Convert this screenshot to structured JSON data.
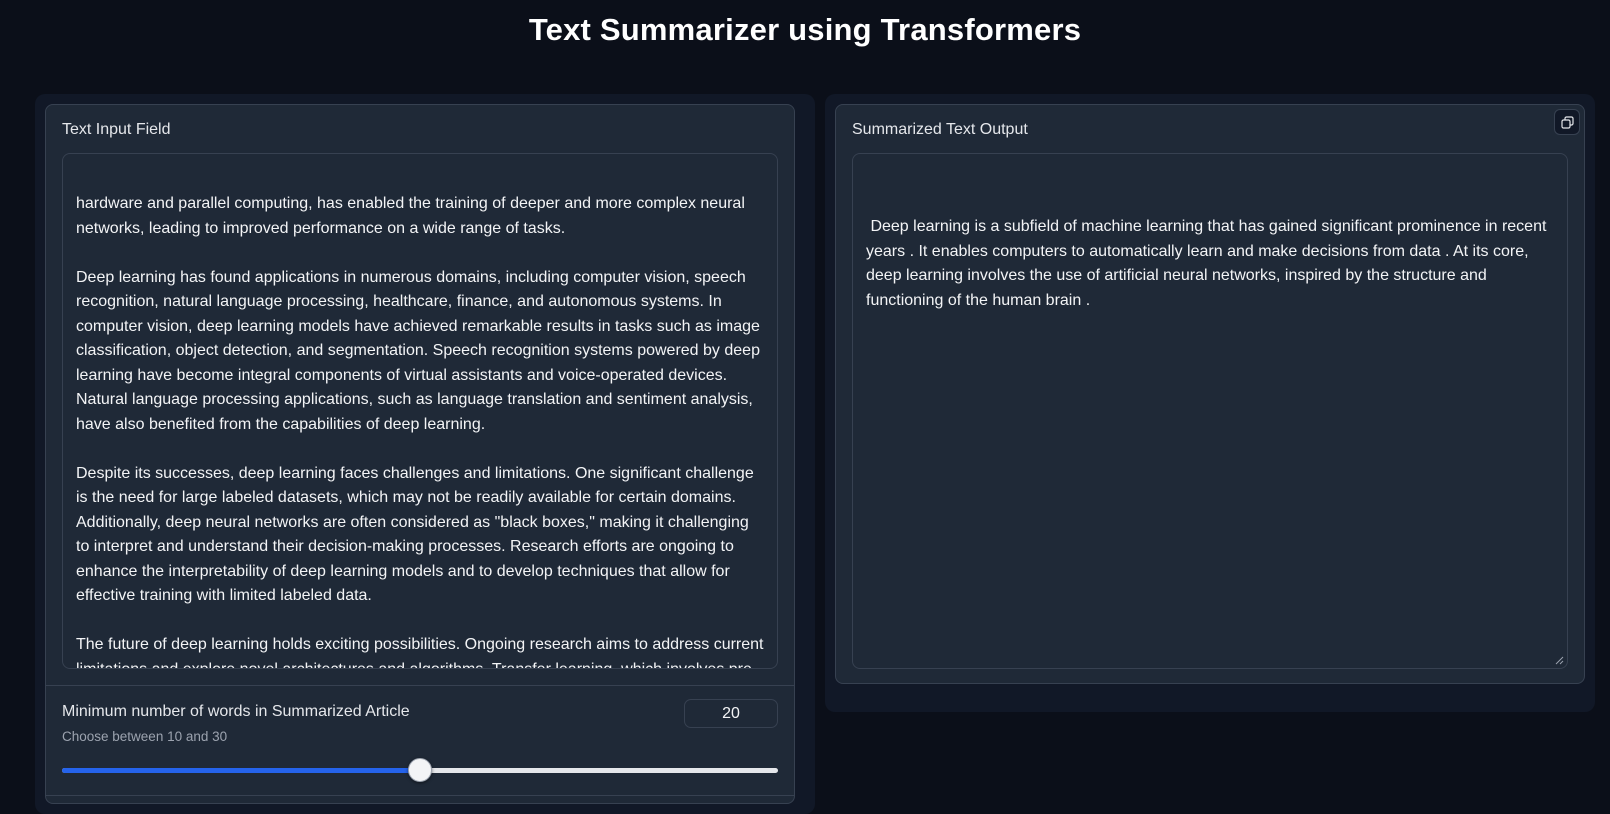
{
  "page": {
    "title": "Text Summarizer using Transformers"
  },
  "input": {
    "label": "Text Input Field",
    "text": "hardware and parallel computing, has enabled the training of deeper and more complex neural networks, leading to improved performance on a wide range of tasks.\n\nDeep learning has found applications in numerous domains, including computer vision, speech recognition, natural language processing, healthcare, finance, and autonomous systems. In computer vision, deep learning models have achieved remarkable results in tasks such as image classification, object detection, and segmentation. Speech recognition systems powered by deep learning have become integral components of virtual assistants and voice-operated devices. Natural language processing applications, such as language translation and sentiment analysis, have also benefited from the capabilities of deep learning.\n\nDespite its successes, deep learning faces challenges and limitations. One significant challenge is the need for large labeled datasets, which may not be readily available for certain domains. Additionally, deep neural networks are often considered as \"black boxes,\" making it challenging to interpret and understand their decision-making processes. Research efforts are ongoing to enhance the interpretability of deep learning models and to develop techniques that allow for effective training with limited labeled data.\n\nThe future of deep learning holds exciting possibilities. Ongoing research aims to address current limitations and explore novel architectures and algorithms. Transfer learning, which involves pre-training a model on a large dataset and fine-tuning it for a specific task, has"
  },
  "slider": {
    "label": "Minimum number of words in Summarized Article",
    "info": "Choose between 10 and 30",
    "value": "20",
    "min": 10,
    "max": 30,
    "fraction": 0.5,
    "fill_color": "#2563eb"
  },
  "output": {
    "label": "Summarized Text Output",
    "text": " Deep learning is a subfield of machine learning that has gained significant prominence in recent years . It enables computers to automatically learn and make decisions from data . At its core, deep learning involves the use of artificial neural networks, inspired by the structure and functioning of the human brain .",
    "copy_icon": "copy-icon"
  }
}
